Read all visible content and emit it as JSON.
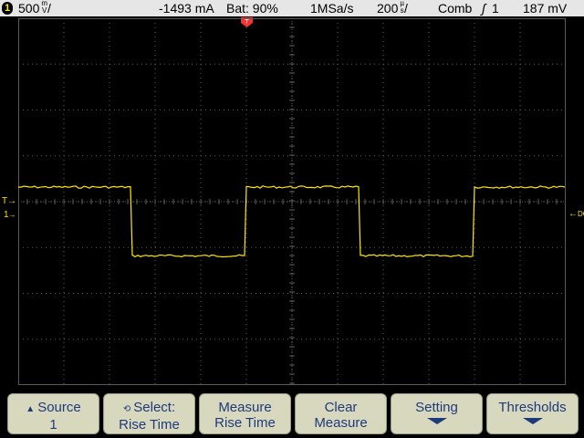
{
  "status": {
    "channel": "1",
    "volts_div": "500",
    "volts_unit_top": "m",
    "volts_unit_bottom": "V",
    "volts_suffix": "/",
    "current": "-1493 mA",
    "battery": "Bat: 90%",
    "sample_rate": "1MSa/s",
    "time_div": "200",
    "time_unit_top": "µ",
    "time_unit_bottom": "s",
    "time_suffix": "/",
    "acq_mode": "Comb",
    "trigger_icon": "ʃ",
    "trigger_source": "1",
    "trigger_level": "187 mV"
  },
  "markers": {
    "trigger_time": "T",
    "trigger_level_left": "T",
    "channel_ground": "1",
    "coupling": "DC"
  },
  "colors": {
    "trace": "#ffe800",
    "grid": "#5a5a5a",
    "marker_red": "#ff3030",
    "softkey_bg": "#d8d8bf",
    "softkey_text": "#1f3a7a"
  },
  "waveform": {
    "channel": "1",
    "shape": "square",
    "high_div": 0.0,
    "low_div": -1.5,
    "transitions_div": [
      2.5,
      5.0,
      7.5,
      10.0
    ]
  },
  "softkeys": [
    {
      "icon": "arrow-up-icon",
      "line1": "Source",
      "line2": "1"
    },
    {
      "icon": "select-knob-icon",
      "line1": "Select:",
      "line2": "Rise Time"
    },
    {
      "icon": "",
      "line1": "Measure",
      "line2": "Rise Time"
    },
    {
      "icon": "",
      "line1": "Clear",
      "line2": "Measure"
    },
    {
      "icon": "arrow-down-icon",
      "line1": "Setting",
      "line2": ""
    },
    {
      "icon": "arrow-down-icon",
      "line1": "Thresholds",
      "line2": ""
    }
  ]
}
